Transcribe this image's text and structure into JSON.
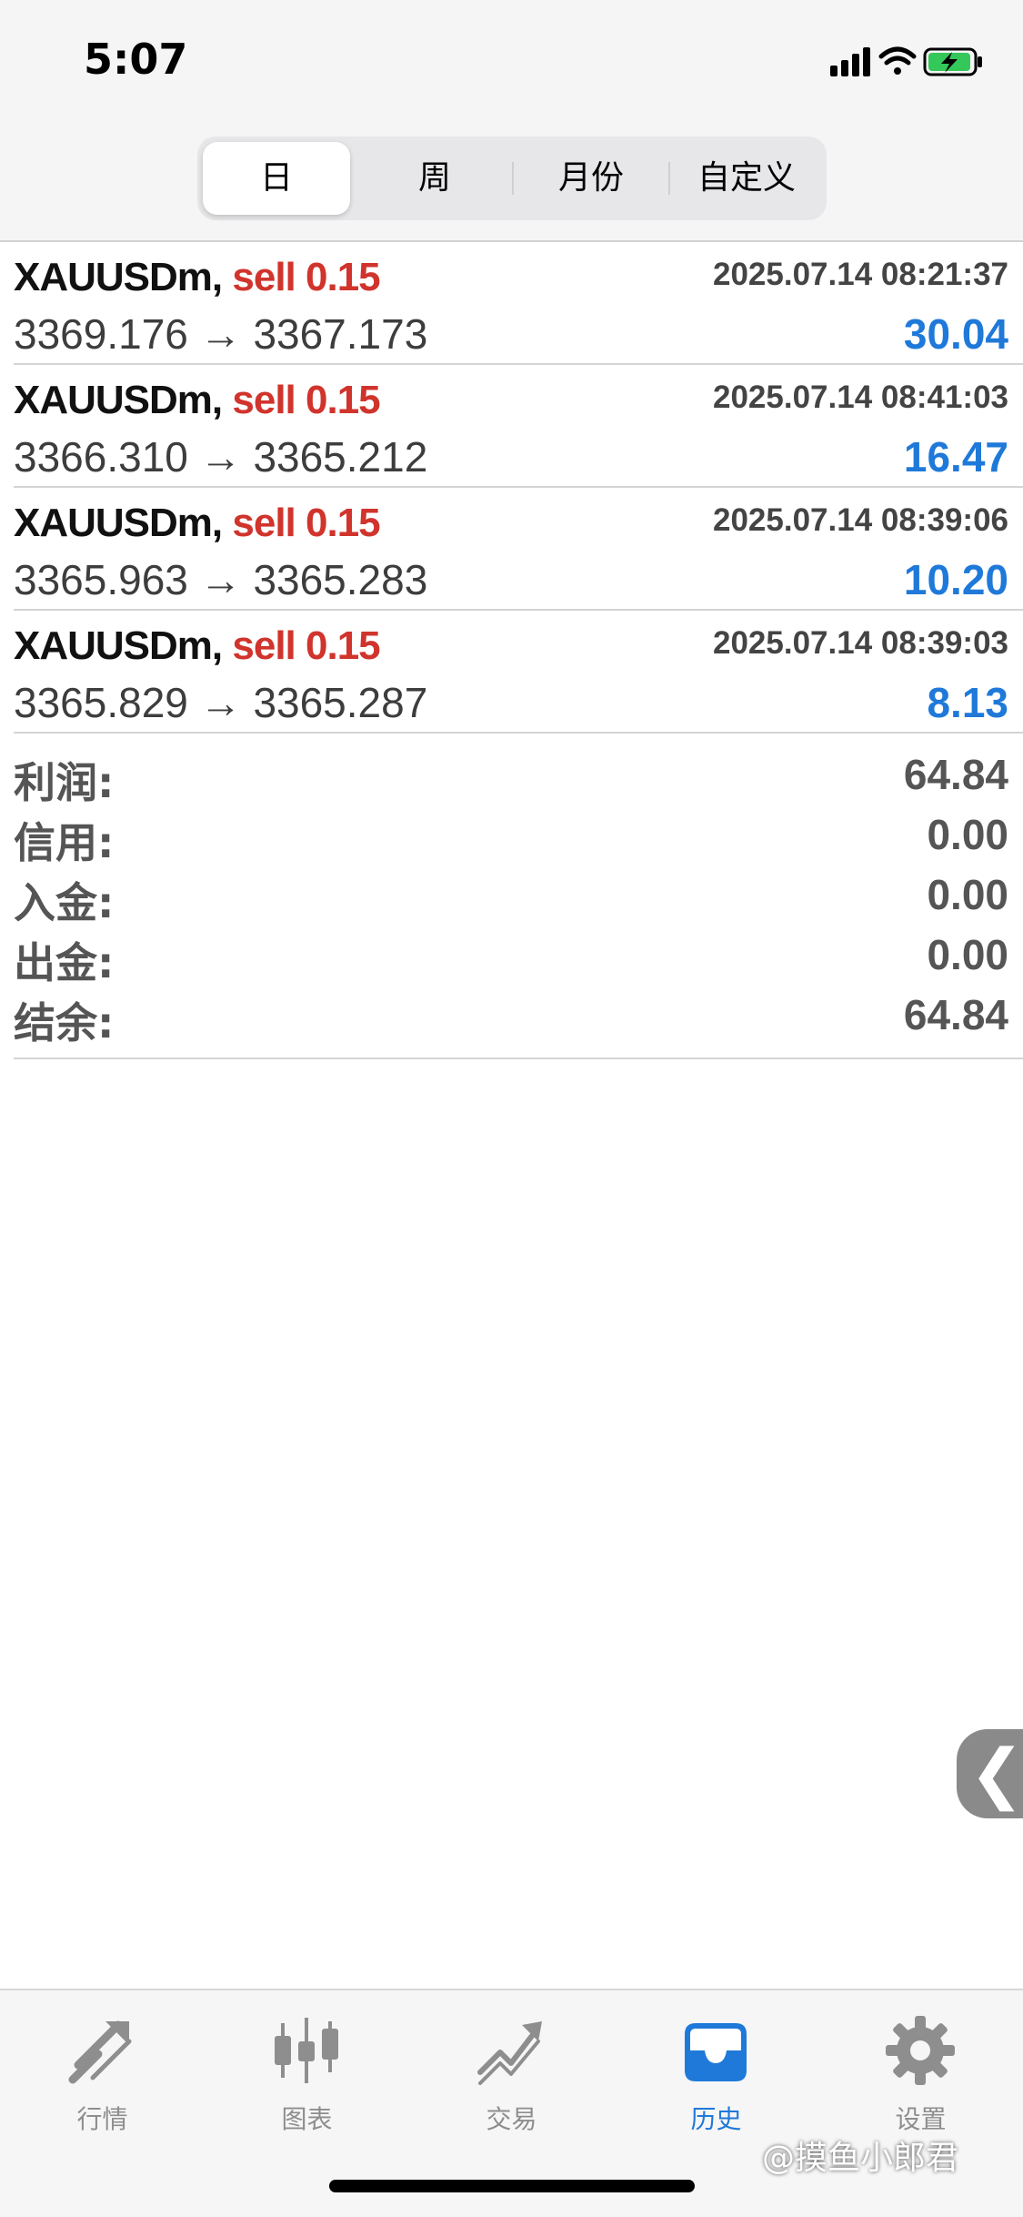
{
  "status_bar": {
    "time": "5:07"
  },
  "segments": [
    "日",
    "周",
    "月份",
    "自定义"
  ],
  "deals": [
    {
      "symbol": "XAUUSDm,",
      "side": "sell 0.15",
      "time": "2025.07.14 08:21:37",
      "open": "3369.176",
      "arrow": "→",
      "close": "3367.173",
      "profit": "30.04"
    },
    {
      "symbol": "XAUUSDm,",
      "side": "sell 0.15",
      "time": "2025.07.14 08:41:03",
      "open": "3366.310",
      "arrow": "→",
      "close": "3365.212",
      "profit": "16.47"
    },
    {
      "symbol": "XAUUSDm,",
      "side": "sell 0.15",
      "time": "2025.07.14 08:39:06",
      "open": "3365.963",
      "arrow": "→",
      "close": "3365.283",
      "profit": "10.20"
    },
    {
      "symbol": "XAUUSDm,",
      "side": "sell 0.15",
      "time": "2025.07.14 08:39:03",
      "open": "3365.829",
      "arrow": "→",
      "close": "3365.287",
      "profit": "8.13"
    }
  ],
  "summary": [
    {
      "label": "利润:",
      "value": "64.84"
    },
    {
      "label": "信用:",
      "value": "0.00"
    },
    {
      "label": "入金:",
      "value": "0.00"
    },
    {
      "label": "出金:",
      "value": "0.00"
    },
    {
      "label": "结余:",
      "value": "64.84"
    }
  ],
  "side_handle": "❮",
  "tabbar": [
    {
      "label": "行情",
      "icon": "quotes-arrows-icon"
    },
    {
      "label": "图表",
      "icon": "candlestick-icon"
    },
    {
      "label": "交易",
      "icon": "trade-trend-icon"
    },
    {
      "label": "历史",
      "icon": "inbox-tray-icon"
    },
    {
      "label": "设置",
      "icon": "gear-icon"
    }
  ],
  "watermark": "@摸鱼小郎君",
  "colors": {
    "sell": "#d0342c",
    "profit": "#1f79d9",
    "active_tab": "#1f79d9",
    "inactive_tab": "#8e8e8e"
  }
}
